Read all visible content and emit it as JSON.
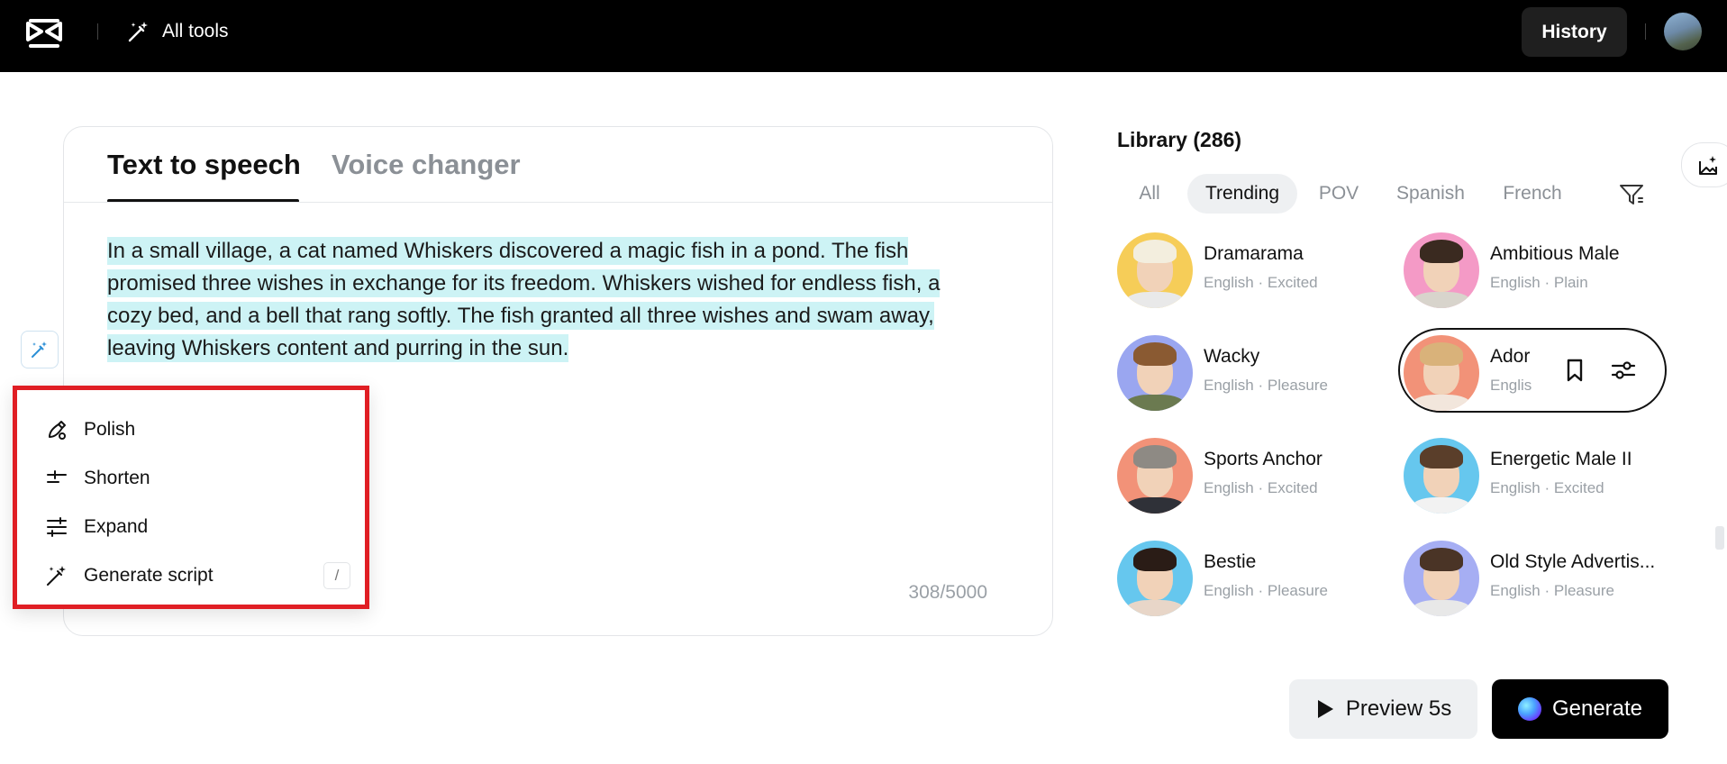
{
  "topbar": {
    "all_tools_label": "All tools",
    "history_label": "History"
  },
  "editor": {
    "tabs": [
      {
        "label": "Text to speech",
        "active": true
      },
      {
        "label": "Voice changer",
        "active": false
      }
    ],
    "text_lines": [
      "In a small village, a cat named Whiskers discovered a magic fish in a pond. The fish",
      "promised three wishes in exchange for its freedom. Whiskers wished for endless fish, a",
      "cozy bed, and a bell that rang softly. The fish granted all three wishes and swam away,",
      "leaving Whiskers content and purring in the sun."
    ],
    "char_count": "308/5000"
  },
  "ai_menu": {
    "items": [
      {
        "label": "Polish",
        "icon": "polish-icon"
      },
      {
        "label": "Shorten",
        "icon": "shorten-icon"
      },
      {
        "label": "Expand",
        "icon": "expand-icon"
      },
      {
        "label": "Generate script",
        "icon": "generate-script-icon",
        "shortcut": "/"
      }
    ]
  },
  "library": {
    "title": "Library (286)",
    "filters": [
      {
        "label": "All",
        "active": false
      },
      {
        "label": "Trending",
        "active": true
      },
      {
        "label": "POV",
        "active": false
      },
      {
        "label": "Spanish",
        "active": false
      },
      {
        "label": "French",
        "active": false
      }
    ],
    "voices": [
      {
        "name": "Dramarama",
        "meta": "English · Excited",
        "bg": "#f6cd58"
      },
      {
        "name": "Ambitious Male",
        "meta": "English · Plain",
        "bg": "#f49ac6"
      },
      {
        "name": "Wacky",
        "meta": "English · Pleasure",
        "bg": "#9aa6f0"
      },
      {
        "name": "Ador",
        "meta": "Englis",
        "bg": "#f29278",
        "selected": true
      },
      {
        "name": "Sports Anchor",
        "meta": "English · Excited",
        "bg": "#f29278"
      },
      {
        "name": "Energetic Male II",
        "meta": "English · Excited",
        "bg": "#66c7ee"
      },
      {
        "name": "Bestie",
        "meta": "English · Pleasure",
        "bg": "#66c7ee"
      },
      {
        "name": "Old Style Advertis...",
        "meta": "English · Pleasure",
        "bg": "#a6aef3"
      }
    ]
  },
  "actions": {
    "preview_label": "Preview 5s",
    "generate_label": "Generate"
  }
}
